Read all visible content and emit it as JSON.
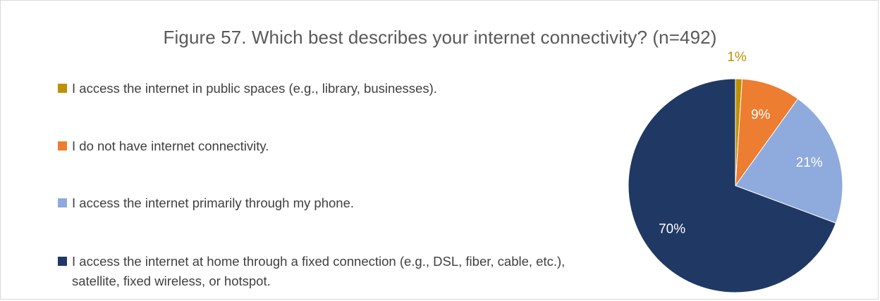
{
  "chart_data": {
    "type": "pie",
    "title": "Figure 57. Which best describes your internet connectivity? (n=492)",
    "legend_position": "left",
    "slices": [
      {
        "label": "I access the internet in public spaces (e.g., library, businesses).",
        "value": 1,
        "display": "1%",
        "color": "#bf9000",
        "label_color": "#bf9000"
      },
      {
        "label": "I do not have internet connectivity.",
        "value": 9,
        "display": "9%",
        "color": "#ed7d31",
        "label_color": "#ffffff"
      },
      {
        "label": "I access the internet primarily through my phone.",
        "value": 21,
        "display": "21%",
        "color": "#8faadc",
        "label_color": "#ffffff"
      },
      {
        "label": "I access the internet at home through a fixed connection (e.g., DSL, fiber, cable, etc.), satellite, fixed wireless, or hotspot.",
        "value": 70,
        "display": "70%",
        "color": "#203864",
        "label_color": "#ffffff"
      }
    ]
  }
}
